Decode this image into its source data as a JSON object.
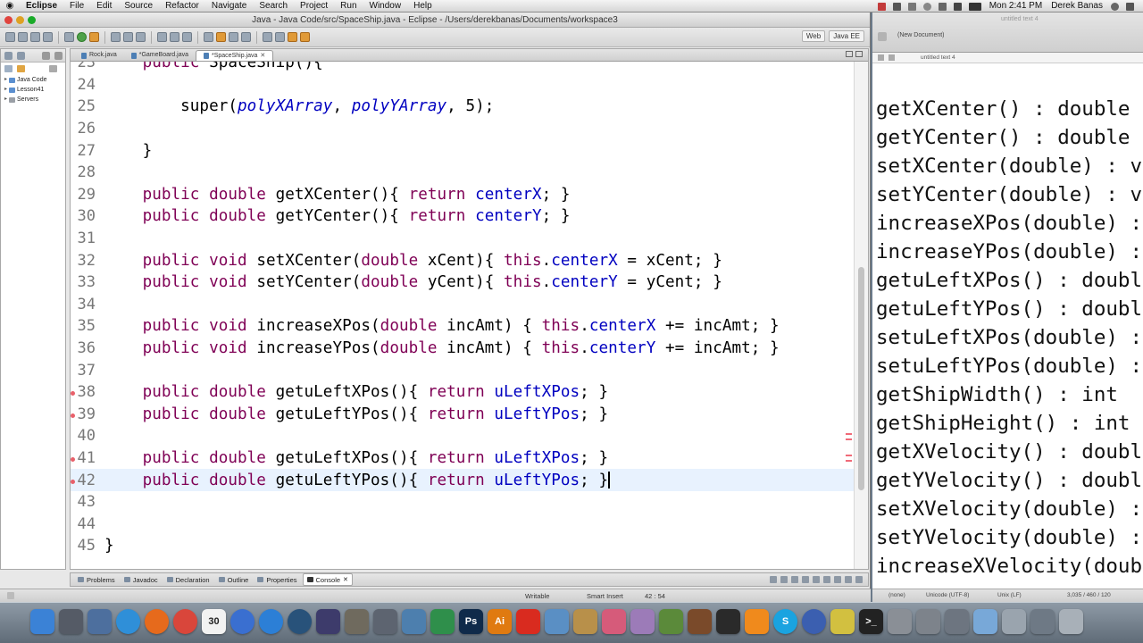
{
  "menubar": {
    "apple": "",
    "app": "Eclipse",
    "items": [
      "File",
      "Edit",
      "Source",
      "Refactor",
      "Navigate",
      "Search",
      "Project",
      "Run",
      "Window",
      "Help"
    ],
    "clock": "Mon 2:41 PM",
    "user": "Derek Banas"
  },
  "window": {
    "title": "Java - Java Code/src/SpaceShip.java - Eclipse - /Users/derekbanas/Documents/workspace3",
    "perspectives": [
      "Web",
      "Java EE"
    ]
  },
  "package_explorer": {
    "items": [
      "Java Code",
      "Lesson41",
      "Servers"
    ]
  },
  "editor": {
    "tabs": [
      "Rock.java",
      "*GameBoard.java",
      "*SpaceShip.java"
    ],
    "active_tab": 2,
    "lines": [
      {
        "n": "23",
        "tokens": [
          {
            "t": "    "
          },
          {
            "t": "public",
            "c": "kw"
          },
          {
            "t": " SpaceShip(){"
          }
        ]
      },
      {
        "n": "24",
        "tokens": []
      },
      {
        "n": "25",
        "tokens": [
          {
            "t": "        super("
          },
          {
            "t": "polyXArray",
            "c": "it"
          },
          {
            "t": ", "
          },
          {
            "t": "polyYArray",
            "c": "it"
          },
          {
            "t": ", 5);"
          }
        ]
      },
      {
        "n": "26",
        "tokens": []
      },
      {
        "n": "27",
        "tokens": [
          {
            "t": "    }"
          }
        ]
      },
      {
        "n": "28",
        "tokens": []
      },
      {
        "n": "29",
        "tokens": [
          {
            "t": "    "
          },
          {
            "t": "public",
            "c": "kw"
          },
          {
            "t": " "
          },
          {
            "t": "double",
            "c": "kw"
          },
          {
            "t": " getXCenter(){ "
          },
          {
            "t": "return",
            "c": "kw"
          },
          {
            "t": " "
          },
          {
            "t": "centerX",
            "c": "fld"
          },
          {
            "t": "; }"
          }
        ]
      },
      {
        "n": "30",
        "tokens": [
          {
            "t": "    "
          },
          {
            "t": "public",
            "c": "kw"
          },
          {
            "t": " "
          },
          {
            "t": "double",
            "c": "kw"
          },
          {
            "t": " getYCenter(){ "
          },
          {
            "t": "return",
            "c": "kw"
          },
          {
            "t": " "
          },
          {
            "t": "centerY",
            "c": "fld"
          },
          {
            "t": "; }"
          }
        ]
      },
      {
        "n": "31",
        "tokens": []
      },
      {
        "n": "32",
        "tokens": [
          {
            "t": "    "
          },
          {
            "t": "public",
            "c": "kw"
          },
          {
            "t": " "
          },
          {
            "t": "void",
            "c": "kw"
          },
          {
            "t": " setXCenter("
          },
          {
            "t": "double",
            "c": "kw"
          },
          {
            "t": " xCent){ "
          },
          {
            "t": "this",
            "c": "kw"
          },
          {
            "t": "."
          },
          {
            "t": "centerX",
            "c": "fld"
          },
          {
            "t": " = xCent; }"
          }
        ]
      },
      {
        "n": "33",
        "tokens": [
          {
            "t": "    "
          },
          {
            "t": "public",
            "c": "kw"
          },
          {
            "t": " "
          },
          {
            "t": "void",
            "c": "kw"
          },
          {
            "t": " setYCenter("
          },
          {
            "t": "double",
            "c": "kw"
          },
          {
            "t": " yCent){ "
          },
          {
            "t": "this",
            "c": "kw"
          },
          {
            "t": "."
          },
          {
            "t": "centerY",
            "c": "fld"
          },
          {
            "t": " = yCent; }"
          }
        ]
      },
      {
        "n": "34",
        "tokens": []
      },
      {
        "n": "35",
        "tokens": [
          {
            "t": "    "
          },
          {
            "t": "public",
            "c": "kw"
          },
          {
            "t": " "
          },
          {
            "t": "void",
            "c": "kw"
          },
          {
            "t": " increaseXPos("
          },
          {
            "t": "double",
            "c": "kw"
          },
          {
            "t": " incAmt) { "
          },
          {
            "t": "this",
            "c": "kw"
          },
          {
            "t": "."
          },
          {
            "t": "centerX",
            "c": "fld"
          },
          {
            "t": " += incAmt; }"
          }
        ]
      },
      {
        "n": "36",
        "tokens": [
          {
            "t": "    "
          },
          {
            "t": "public",
            "c": "kw"
          },
          {
            "t": " "
          },
          {
            "t": "void",
            "c": "kw"
          },
          {
            "t": " increaseYPos("
          },
          {
            "t": "double",
            "c": "kw"
          },
          {
            "t": " incAmt) { "
          },
          {
            "t": "this",
            "c": "kw"
          },
          {
            "t": "."
          },
          {
            "t": "centerY",
            "c": "fld"
          },
          {
            "t": " += incAmt; }"
          }
        ]
      },
      {
        "n": "37",
        "tokens": []
      },
      {
        "n": "38",
        "mark": true,
        "tokens": [
          {
            "t": "    "
          },
          {
            "t": "public",
            "c": "kw"
          },
          {
            "t": " "
          },
          {
            "t": "double",
            "c": "kw"
          },
          {
            "t": " getuLeftXPos(){ "
          },
          {
            "t": "return",
            "c": "kw"
          },
          {
            "t": " "
          },
          {
            "t": "uLeftXPos",
            "c": "fld"
          },
          {
            "t": "; }"
          }
        ]
      },
      {
        "n": "39",
        "mark": true,
        "tokens": [
          {
            "t": "    "
          },
          {
            "t": "public",
            "c": "kw"
          },
          {
            "t": " "
          },
          {
            "t": "double",
            "c": "kw"
          },
          {
            "t": " getuLeftYPos(){ "
          },
          {
            "t": "return",
            "c": "kw"
          },
          {
            "t": " "
          },
          {
            "t": "uLeftYPos",
            "c": "fld"
          },
          {
            "t": "; }"
          }
        ]
      },
      {
        "n": "40",
        "tokens": []
      },
      {
        "n": "41",
        "mark": true,
        "tokens": [
          {
            "t": "    "
          },
          {
            "t": "public",
            "c": "kw"
          },
          {
            "t": " "
          },
          {
            "t": "double",
            "c": "kw"
          },
          {
            "t": " getuLeftXPos(){ "
          },
          {
            "t": "return",
            "c": "kw"
          },
          {
            "t": " "
          },
          {
            "t": "uLeftXPos",
            "c": "fld"
          },
          {
            "t": "; }"
          }
        ]
      },
      {
        "n": "42",
        "mark": true,
        "current": true,
        "tokens": [
          {
            "t": "    "
          },
          {
            "t": "public",
            "c": "kw"
          },
          {
            "t": " "
          },
          {
            "t": "double",
            "c": "kw"
          },
          {
            "t": " getuLeftYPos(){ "
          },
          {
            "t": "return",
            "c": "kw"
          },
          {
            "t": " "
          },
          {
            "t": "uLeftYPos",
            "c": "fld"
          },
          {
            "t": "; }"
          }
        ]
      },
      {
        "n": "43",
        "tokens": []
      },
      {
        "n": "44",
        "tokens": []
      },
      {
        "n": "45",
        "tokens": [
          {
            "t": "}"
          }
        ]
      }
    ]
  },
  "bottom_views": {
    "tabs": [
      "Problems",
      "Javadoc",
      "Declaration",
      "Outline",
      "Properties",
      "Console"
    ],
    "active": 5
  },
  "status": {
    "writable": "Writable",
    "insert": "Smart Insert",
    "position": "42 : 54"
  },
  "text_window": {
    "title": "untitled text 4",
    "doc": "(New Document)",
    "tab": "untitled text 4",
    "methods": [
      "getXCenter() : double",
      "getYCenter() : double",
      "setXCenter(double) : v",
      "setYCenter(double) : v",
      "increaseXPos(double) :",
      "increaseYPos(double) :",
      "getuLeftXPos() : doubl",
      "getuLeftYPos() : doubl",
      "setuLeftXPos(double) :",
      "setuLeftYPos(double) :",
      "getShipWidth() : int",
      "getShipHeight() : int",
      "getXVelocity() : doubl",
      "getYVelocity() : doubl",
      "setXVelocity(double) :",
      "setYVelocity(double) :",
      "increaseXVelocity(doub"
    ],
    "status": {
      "mode": "(none)",
      "encoding": "Unicode (UTF-8)",
      "eol": "Unix (LF)",
      "stats": "3,035 / 460 / 120"
    }
  },
  "dock": {
    "icons": [
      {
        "name": "finder-icon",
        "color": "#3b82d6",
        "label": ""
      },
      {
        "name": "launchpad-icon",
        "color": "#555b66",
        "label": ""
      },
      {
        "name": "preview-icon",
        "color": "#4d6f9e",
        "label": ""
      },
      {
        "name": "safari-icon",
        "color": "#2f8fd8",
        "label": ""
      },
      {
        "name": "firefox-icon",
        "color": "#e66a1c",
        "label": ""
      },
      {
        "name": "chrome-icon",
        "color": "#d9463b",
        "label": ""
      },
      {
        "name": "calendar-icon",
        "color": "#f2f2f2",
        "label": "30"
      },
      {
        "name": "itunes-icon",
        "color": "#3a6fd0",
        "label": ""
      },
      {
        "name": "appstore-icon",
        "color": "#2c7fd6",
        "label": ""
      },
      {
        "name": "quicktime-icon",
        "color": "#28527a",
        "label": ""
      },
      {
        "name": "eclipse-icon",
        "color": "#3d3b6b",
        "label": ""
      },
      {
        "name": "starfish-icon",
        "color": "#6f6a5e",
        "label": ""
      },
      {
        "name": "utility-icon",
        "color": "#5d6470",
        "label": ""
      },
      {
        "name": "xcode-icon",
        "color": "#4d7fae",
        "label": ""
      },
      {
        "name": "numbers-icon",
        "color": "#2f8f4b",
        "label": ""
      },
      {
        "name": "photoshop-icon",
        "color": "#0f2a4a",
        "label": "Ps"
      },
      {
        "name": "illustrator-icon",
        "color": "#e07a10",
        "label": "Ai"
      },
      {
        "name": "acrobat-icon",
        "color": "#d92b1f",
        "label": ""
      },
      {
        "name": "settings-icon",
        "color": "#5a8fc4",
        "label": ""
      },
      {
        "name": "gimp-icon",
        "color": "#b8904a",
        "label": ""
      },
      {
        "name": "paint-icon",
        "color": "#d65b7a",
        "label": ""
      },
      {
        "name": "sheep-icon",
        "color": "#9c7bb8",
        "label": ""
      },
      {
        "name": "minecraft-icon",
        "color": "#5b8a3a",
        "label": ""
      },
      {
        "name": "books-icon",
        "color": "#7a4a2a",
        "label": ""
      },
      {
        "name": "clapper-icon",
        "color": "#2a2a2a",
        "label": ""
      },
      {
        "name": "vlc-icon",
        "color": "#f08a1c",
        "label": ""
      },
      {
        "name": "skype-icon",
        "color": "#1aa3e0",
        "label": "S"
      },
      {
        "name": "globe-icon",
        "color": "#3b5fb0",
        "label": ""
      },
      {
        "name": "sparkle-icon",
        "color": "#d2c040",
        "label": ""
      },
      {
        "name": "terminal-icon",
        "color": "#222222",
        "label": ">_"
      },
      {
        "name": "keypad-icon",
        "color": "#8a8f96",
        "label": ""
      },
      {
        "name": "scissors-icon",
        "color": "#7d838b",
        "label": ""
      },
      {
        "name": "network-icon",
        "color": "#6d7580",
        "label": ""
      },
      {
        "name": "folder-icon",
        "color": "#78a8d8",
        "label": ""
      },
      {
        "name": "monitor-icon",
        "color": "#9aa4ae",
        "label": ""
      },
      {
        "name": "downloads-icon",
        "color": "#6e7985",
        "label": ""
      },
      {
        "name": "trash-icon",
        "color": "#a8b0b8",
        "label": ""
      }
    ]
  },
  "colors": {
    "keyword": "#7f0055",
    "field": "#0000c0",
    "current_line": "#e8f2fe"
  }
}
